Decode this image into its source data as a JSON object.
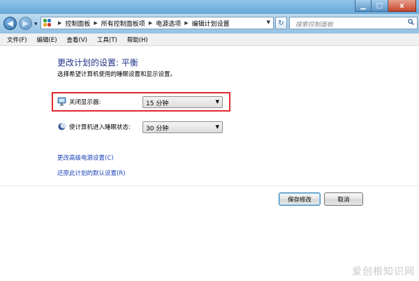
{
  "window": {
    "minimize_label": "▁",
    "maximize_label": "□",
    "close_label": "x"
  },
  "nav": {
    "back_icon": "arrow-left-icon",
    "forward_icon": "arrow-right-icon",
    "breadcrumbs": [
      "控制面板",
      "所有控制面板项",
      "电源选项",
      "编辑计划设置"
    ],
    "search_placeholder": "搜索控制面板"
  },
  "menu": {
    "items": [
      "文件(F)",
      "编辑(E)",
      "查看(V)",
      "工具(T)",
      "帮助(H)"
    ]
  },
  "page": {
    "title": "更改计划的设置: 平衡",
    "subtitle": "选择希望计算机使用的睡眠设置和显示设置。",
    "display_off_label": "关闭显示器:",
    "display_off_value": "15 分钟",
    "sleep_label": "使计算机进入睡眠状态:",
    "sleep_value": "30 分钟",
    "advanced_link": "更改高级电源设置(C)",
    "restore_link": "还原此计划的默认设置(R)",
    "save_button": "保存修改",
    "cancel_button": "取消"
  },
  "watermark": "爱创根知识网",
  "colors": {
    "title": "#1e3287",
    "link": "#1a44b7",
    "highlight_border": "#e0282e"
  }
}
